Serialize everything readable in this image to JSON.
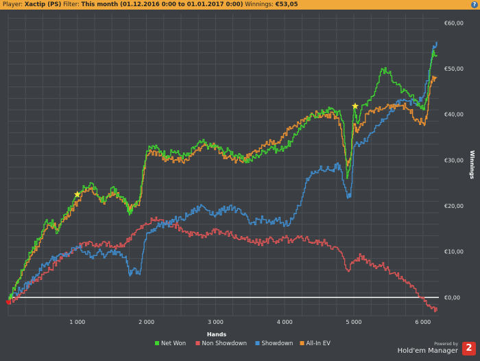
{
  "header": {
    "player_label": "Player:",
    "player_value": "Xactip (PS)",
    "filter_label": "Filter:",
    "filter_value": "This month (01.12.2016 0:00 to 01.01.2017 0:00)",
    "winnings_label": "Winnings:",
    "winnings_value": "€53,05",
    "help_glyph": "?"
  },
  "branding": {
    "powered_by": "Powered by",
    "product": "Hold'em Manager",
    "badge": "2"
  },
  "chart_data": {
    "type": "line",
    "title": "",
    "xlabel": "Hands",
    "ylabel": "Winnings",
    "xlim": [
      0,
      6230
    ],
    "ylim": [
      -4,
      62
    ],
    "x_ticks": [
      1000,
      2000,
      3000,
      4000,
      5000,
      6000
    ],
    "x_tick_labels": [
      "1 000",
      "2 000",
      "3 000",
      "4 000",
      "5 000",
      "6 000"
    ],
    "y_ticks": [
      0,
      10,
      20,
      30,
      40,
      50,
      60
    ],
    "y_tick_labels": [
      "€0,00",
      "€10,00",
      "€20,00",
      "€30,00",
      "€40,00",
      "€50,00",
      "€60,00"
    ],
    "grid": true,
    "legend_position": "bottom",
    "series": [
      {
        "name": "Net Won",
        "color": "#3fd42f",
        "points": [
          [
            0,
            -1
          ],
          [
            80,
            2
          ],
          [
            150,
            4
          ],
          [
            250,
            8
          ],
          [
            350,
            11
          ],
          [
            450,
            13
          ],
          [
            550,
            17
          ],
          [
            650,
            16
          ],
          [
            700,
            14
          ],
          [
            800,
            18
          ],
          [
            900,
            20
          ],
          [
            1000,
            22
          ],
          [
            1100,
            24
          ],
          [
            1200,
            25
          ],
          [
            1300,
            22
          ],
          [
            1400,
            21
          ],
          [
            1500,
            24
          ],
          [
            1600,
            22
          ],
          [
            1700,
            21
          ],
          [
            1750,
            18
          ],
          [
            1800,
            20
          ],
          [
            1900,
            22
          ],
          [
            1950,
            28
          ],
          [
            2000,
            32
          ],
          [
            2100,
            33
          ],
          [
            2200,
            32
          ],
          [
            2300,
            31
          ],
          [
            2400,
            32
          ],
          [
            2500,
            31
          ],
          [
            2600,
            31
          ],
          [
            2700,
            33
          ],
          [
            2800,
            34
          ],
          [
            2900,
            33
          ],
          [
            3000,
            33
          ],
          [
            3100,
            32
          ],
          [
            3200,
            32
          ],
          [
            3300,
            31
          ],
          [
            3400,
            30
          ],
          [
            3500,
            30
          ],
          [
            3600,
            31
          ],
          [
            3700,
            32
          ],
          [
            3800,
            33
          ],
          [
            3900,
            32
          ],
          [
            4000,
            33
          ],
          [
            4100,
            34
          ],
          [
            4200,
            37
          ],
          [
            4300,
            38
          ],
          [
            4400,
            40
          ],
          [
            4500,
            40
          ],
          [
            4600,
            41
          ],
          [
            4700,
            41
          ],
          [
            4800,
            40
          ],
          [
            4850,
            38
          ],
          [
            4900,
            26
          ],
          [
            4950,
            30
          ],
          [
            5000,
            42
          ],
          [
            5050,
            38
          ],
          [
            5100,
            41
          ],
          [
            5200,
            43
          ],
          [
            5300,
            45
          ],
          [
            5400,
            50
          ],
          [
            5500,
            49
          ],
          [
            5600,
            47
          ],
          [
            5700,
            45
          ],
          [
            5800,
            44
          ],
          [
            5900,
            43
          ],
          [
            6000,
            41
          ],
          [
            6050,
            43
          ],
          [
            6100,
            50
          ],
          [
            6150,
            54
          ],
          [
            6200,
            53
          ]
        ]
      },
      {
        "name": "Non Showdown",
        "color": "#e05555",
        "points": [
          [
            0,
            -1
          ],
          [
            100,
            0
          ],
          [
            200,
            1
          ],
          [
            300,
            3
          ],
          [
            400,
            4
          ],
          [
            500,
            5
          ],
          [
            600,
            6
          ],
          [
            700,
            8
          ],
          [
            800,
            9
          ],
          [
            900,
            10
          ],
          [
            1000,
            11
          ],
          [
            1100,
            12
          ],
          [
            1200,
            12
          ],
          [
            1300,
            11
          ],
          [
            1400,
            12
          ],
          [
            1500,
            11
          ],
          [
            1600,
            11
          ],
          [
            1700,
            12
          ],
          [
            1800,
            14
          ],
          [
            1900,
            15
          ],
          [
            2000,
            16
          ],
          [
            2100,
            17
          ],
          [
            2200,
            17
          ],
          [
            2300,
            16
          ],
          [
            2400,
            16
          ],
          [
            2500,
            15
          ],
          [
            2600,
            14
          ],
          [
            2700,
            14
          ],
          [
            2800,
            13
          ],
          [
            2900,
            14
          ],
          [
            3000,
            15
          ],
          [
            3100,
            14
          ],
          [
            3200,
            14
          ],
          [
            3300,
            13
          ],
          [
            3400,
            13
          ],
          [
            3500,
            12
          ],
          [
            3600,
            12
          ],
          [
            3700,
            12
          ],
          [
            3800,
            13
          ],
          [
            3900,
            12
          ],
          [
            4000,
            13
          ],
          [
            4100,
            12
          ],
          [
            4200,
            13
          ],
          [
            4300,
            13
          ],
          [
            4400,
            12
          ],
          [
            4500,
            12
          ],
          [
            4600,
            12
          ],
          [
            4700,
            11
          ],
          [
            4800,
            10
          ],
          [
            4900,
            6
          ],
          [
            5000,
            8
          ],
          [
            5100,
            9
          ],
          [
            5200,
            8
          ],
          [
            5300,
            7
          ],
          [
            5400,
            7
          ],
          [
            5500,
            6
          ],
          [
            5600,
            5
          ],
          [
            5700,
            4
          ],
          [
            5800,
            3
          ],
          [
            5900,
            1
          ],
          [
            6000,
            0
          ],
          [
            6100,
            -2
          ],
          [
            6200,
            -3
          ]
        ]
      },
      {
        "name": "Showdown",
        "color": "#3f8fd2",
        "points": [
          [
            0,
            0
          ],
          [
            100,
            1
          ],
          [
            200,
            2
          ],
          [
            300,
            3
          ],
          [
            400,
            5
          ],
          [
            500,
            7
          ],
          [
            600,
            8
          ],
          [
            700,
            9
          ],
          [
            800,
            9
          ],
          [
            900,
            10
          ],
          [
            1000,
            11
          ],
          [
            1100,
            10
          ],
          [
            1200,
            9
          ],
          [
            1300,
            10
          ],
          [
            1400,
            9
          ],
          [
            1500,
            10
          ],
          [
            1600,
            10
          ],
          [
            1700,
            9
          ],
          [
            1750,
            5
          ],
          [
            1800,
            6
          ],
          [
            1900,
            5
          ],
          [
            1950,
            10
          ],
          [
            2000,
            14
          ],
          [
            2100,
            15
          ],
          [
            2200,
            16
          ],
          [
            2300,
            16
          ],
          [
            2400,
            17
          ],
          [
            2500,
            17
          ],
          [
            2600,
            18
          ],
          [
            2700,
            19
          ],
          [
            2800,
            20
          ],
          [
            2900,
            19
          ],
          [
            3000,
            18
          ],
          [
            3100,
            19
          ],
          [
            3200,
            20
          ],
          [
            3300,
            19
          ],
          [
            3400,
            18
          ],
          [
            3500,
            16
          ],
          [
            3600,
            17
          ],
          [
            3700,
            17
          ],
          [
            3800,
            16
          ],
          [
            3900,
            17
          ],
          [
            4000,
            16
          ],
          [
            4100,
            17
          ],
          [
            4200,
            20
          ],
          [
            4300,
            25
          ],
          [
            4400,
            27
          ],
          [
            4500,
            28
          ],
          [
            4600,
            28
          ],
          [
            4700,
            28
          ],
          [
            4750,
            29
          ],
          [
            4800,
            28
          ],
          [
            4900,
            22
          ],
          [
            4950,
            22
          ],
          [
            5000,
            33
          ],
          [
            5100,
            34
          ],
          [
            5200,
            35
          ],
          [
            5300,
            37
          ],
          [
            5400,
            39
          ],
          [
            5500,
            40
          ],
          [
            5600,
            42
          ],
          [
            5700,
            43
          ],
          [
            5800,
            43
          ],
          [
            5900,
            42
          ],
          [
            6000,
            44
          ],
          [
            6100,
            50
          ],
          [
            6150,
            55
          ],
          [
            6200,
            55
          ]
        ]
      },
      {
        "name": "All-In EV",
        "color": "#ee9230",
        "points": [
          [
            0,
            -1
          ],
          [
            80,
            2
          ],
          [
            150,
            4
          ],
          [
            250,
            7
          ],
          [
            350,
            10
          ],
          [
            450,
            12
          ],
          [
            550,
            15
          ],
          [
            650,
            16
          ],
          [
            700,
            15
          ],
          [
            800,
            17
          ],
          [
            900,
            19
          ],
          [
            1000,
            21
          ],
          [
            1100,
            23
          ],
          [
            1200,
            24
          ],
          [
            1300,
            22
          ],
          [
            1400,
            21
          ],
          [
            1500,
            23
          ],
          [
            1600,
            22
          ],
          [
            1700,
            21
          ],
          [
            1750,
            19
          ],
          [
            1800,
            20
          ],
          [
            1900,
            21
          ],
          [
            1950,
            26
          ],
          [
            2000,
            31
          ],
          [
            2100,
            32
          ],
          [
            2200,
            31
          ],
          [
            2300,
            30
          ],
          [
            2400,
            30
          ],
          [
            2500,
            30
          ],
          [
            2600,
            30
          ],
          [
            2700,
            32
          ],
          [
            2800,
            33
          ],
          [
            2900,
            33
          ],
          [
            3000,
            33
          ],
          [
            3100,
            31
          ],
          [
            3200,
            31
          ],
          [
            3300,
            30
          ],
          [
            3400,
            30
          ],
          [
            3500,
            31
          ],
          [
            3600,
            32
          ],
          [
            3700,
            33
          ],
          [
            3800,
            34
          ],
          [
            3900,
            34
          ],
          [
            4000,
            36
          ],
          [
            4100,
            37
          ],
          [
            4200,
            38
          ],
          [
            4300,
            39
          ],
          [
            4400,
            40
          ],
          [
            4500,
            40
          ],
          [
            4600,
            40
          ],
          [
            4700,
            40
          ],
          [
            4800,
            38
          ],
          [
            4850,
            33
          ],
          [
            4900,
            29
          ],
          [
            4950,
            30
          ],
          [
            5000,
            38
          ],
          [
            5050,
            36
          ],
          [
            5100,
            38
          ],
          [
            5200,
            40
          ],
          [
            5300,
            41
          ],
          [
            5400,
            41
          ],
          [
            5500,
            42
          ],
          [
            5600,
            42
          ],
          [
            5700,
            42
          ],
          [
            5800,
            41
          ],
          [
            5900,
            39
          ],
          [
            6000,
            38
          ],
          [
            6050,
            39
          ],
          [
            6100,
            46
          ],
          [
            6150,
            48
          ],
          [
            6200,
            48
          ]
        ]
      }
    ],
    "markers": [
      {
        "type": "star",
        "x": 1000,
        "y": 22.5,
        "color": "#ffe23a"
      },
      {
        "type": "star",
        "x": 5020,
        "y": 41.8,
        "color": "#ffe23a"
      },
      {
        "type": "heart",
        "x": 0,
        "y": -1,
        "color": "#e02020"
      }
    ]
  }
}
